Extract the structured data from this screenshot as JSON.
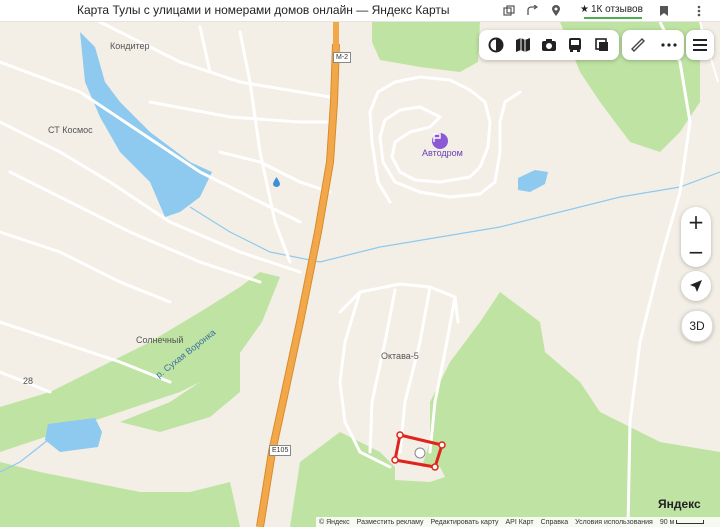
{
  "header": {
    "title": "Карта Тулы с улицами и номерами домов онлайн — Яндекс Карты",
    "reviews_label": "1К отзывов"
  },
  "map": {
    "labels": {
      "konditer": "Кондитер",
      "st_kosmos": "СТ Космос",
      "solnechny": "Солнечный",
      "oktava": "Октава-5",
      "autodrom": "Автодром",
      "river": "р. Сухая Воронка",
      "house_28": "28",
      "route_m2": "М-2",
      "route_e105": "E105"
    },
    "colors": {
      "land": "#f3efe6",
      "forest": "#bfe3a3",
      "water": "#8ec9ef",
      "highway": "#f2a84a",
      "road": "#ffffff",
      "poi": "#6a3fb5",
      "marker": "#e0241b"
    }
  },
  "toolbar": {
    "icons": [
      "layers-icon",
      "map-icon",
      "panorama-icon",
      "transit-icon",
      "traffic-icon"
    ],
    "ruler_icon": "ruler-icon",
    "more_icon": "more-icon",
    "menu_icon": "menu-icon"
  },
  "controls": {
    "zoom_in": "+",
    "zoom_out": "−",
    "btn_3d": "3D"
  },
  "brand": {
    "logo": "Яндекс"
  },
  "footer": {
    "copyright": "© Яндекс",
    "advertise": "Разместить рекламу",
    "edit_map": "Редактировать карту",
    "api": "API Карт",
    "help": "Справка",
    "terms": "Условия использования",
    "scale": "90 м"
  }
}
